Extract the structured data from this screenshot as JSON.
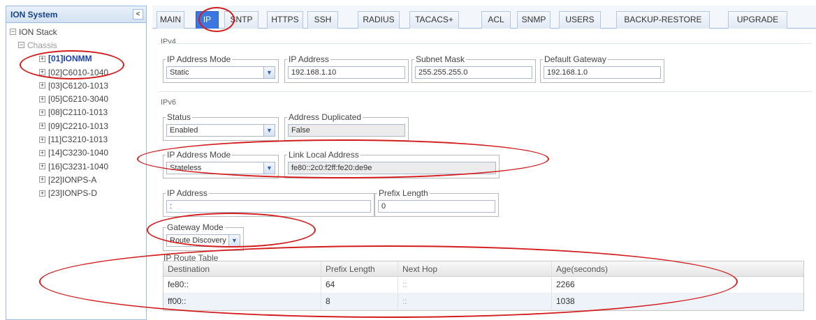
{
  "sidebar": {
    "title": "ION System",
    "collapse_glyph": "<",
    "items": [
      {
        "label": "ION Stack",
        "toggle": "−"
      },
      {
        "label": "Chassis",
        "toggle": "−"
      },
      {
        "label": "[01]IONMM",
        "toggle": "+"
      },
      {
        "label": "[02]C6010-1040",
        "toggle": "+"
      },
      {
        "label": "[03]C6120-1013",
        "toggle": "+"
      },
      {
        "label": "[05]C6210-3040",
        "toggle": "+"
      },
      {
        "label": "[08]C2110-1013",
        "toggle": "+"
      },
      {
        "label": "[09]C2210-1013",
        "toggle": "+"
      },
      {
        "label": "[11]C3210-1013",
        "toggle": "+"
      },
      {
        "label": "[14]C3230-1040",
        "toggle": "+"
      },
      {
        "label": "[16]C3231-1040",
        "toggle": "+"
      },
      {
        "label": "[22]IONPS-A",
        "toggle": "+"
      },
      {
        "label": "[23]IONPS-D",
        "toggle": "+"
      }
    ]
  },
  "tabs": [
    "MAIN",
    "IP",
    "SNTP",
    "HTTPS",
    "SSH",
    "RADIUS",
    "TACACS+",
    "ACL",
    "SNMP",
    "USERS",
    "BACKUP-RESTORE",
    "UPGRADE"
  ],
  "ipv4": {
    "section": "IPv4",
    "mode_label": "IP Address Mode",
    "mode_value": "Static",
    "address_label": "IP Address",
    "address_value": "192.168.1.10",
    "mask_label": "Subnet Mask",
    "mask_value": "255.255.255.0",
    "gateway_label": "Default Gateway",
    "gateway_value": "192.168.1.0"
  },
  "ipv6": {
    "section": "IPv6",
    "status_label": "Status",
    "status_value": "Enabled",
    "dup_label": "Address Duplicated",
    "dup_value": "False",
    "mode_label": "IP Address Mode",
    "mode_value": "Stateless",
    "lla_label": "Link Local Address",
    "lla_value": "fe80::2c0:f2ff:fe20:de9e",
    "address_label": "IP Address",
    "address_value": ":",
    "prefix_label": "Prefix Length",
    "prefix_value": "0",
    "gw_mode_label": "Gateway Mode",
    "gw_mode_value": "Route Discovery",
    "route_table_label": "IP Route Table"
  },
  "route_table": {
    "columns": [
      "Destination",
      "Prefix Length",
      "Next Hop",
      "Age(seconds)"
    ],
    "rows": [
      [
        "fe80::",
        "64",
        "::",
        "2266"
      ],
      [
        "ff00::",
        "8",
        "::",
        "1038"
      ]
    ]
  },
  "colors": {
    "annotation": "#d41b1b",
    "active_tab": "#3a77e0"
  }
}
